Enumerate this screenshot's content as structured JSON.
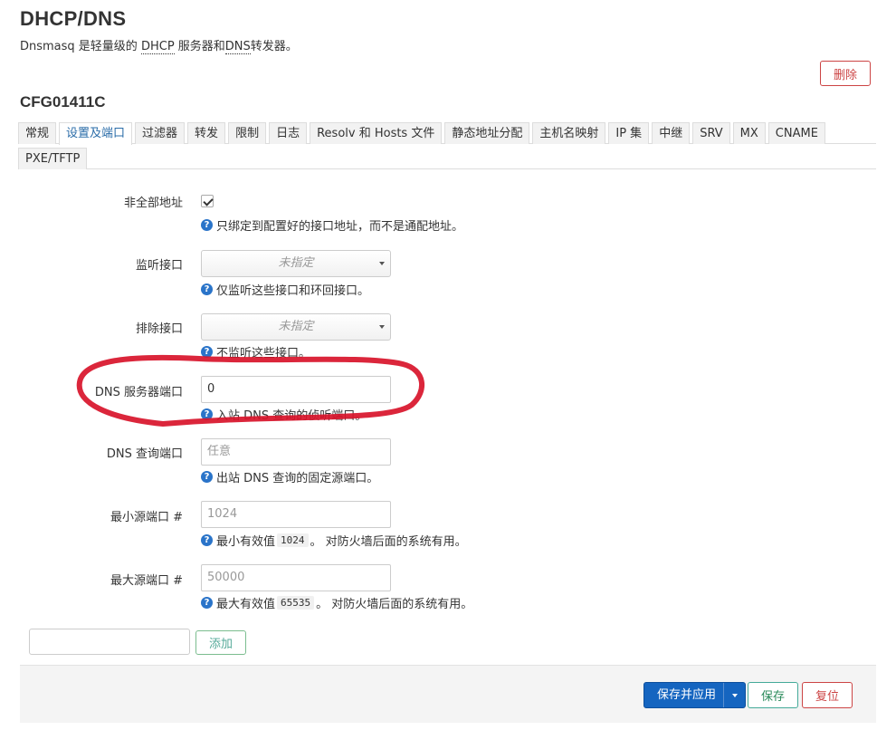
{
  "header": {
    "title": "DHCP/DNS",
    "desc_prefix": "Dnsmasq 是轻量级的 ",
    "desc_dhcp": "DHCP",
    "desc_middle": " 服务器和",
    "desc_dns": "DNS",
    "desc_suffix": "转发器。",
    "delete_label": "删除"
  },
  "section": {
    "title": "CFG01411C"
  },
  "tabs": {
    "row1": [
      "常规",
      "设置及端口",
      "过滤器",
      "转发",
      "限制",
      "日志",
      "Resolv 和 Hosts 文件",
      "静态地址分配",
      "主机名映射",
      "IP 集",
      "中继",
      "SRV",
      "MX",
      "CNAME"
    ],
    "row2": [
      "PXE/TFTP"
    ],
    "active": "设置及端口"
  },
  "form": {
    "nonwildcard": {
      "label": "非全部地址",
      "checked": true,
      "help": "只绑定到配置好的接口地址，而不是通配地址。"
    },
    "listen_iface": {
      "label": "监听接口",
      "value": "未指定",
      "help": "仅监听这些接口和环回接口。"
    },
    "exclude_iface": {
      "label": "排除接口",
      "value": "未指定",
      "help": "不监听这些接口。"
    },
    "dns_port": {
      "label": "DNS 服务器端口",
      "value": "0",
      "help": "入站 DNS 查询的侦听端口。"
    },
    "query_port": {
      "label": "DNS 查询端口",
      "placeholder": "任意",
      "help": "出站 DNS 查询的固定源端口。"
    },
    "min_port": {
      "label": "最小源端口 #",
      "placeholder": "1024",
      "help_prefix": "最小有效值",
      "help_code": "1024",
      "help_suffix": "。 对防火墙后面的系统有用。"
    },
    "max_port": {
      "label": "最大源端口 #",
      "placeholder": "50000",
      "help_prefix": "最大有效值",
      "help_code": "65535",
      "help_suffix": "。 对防火墙后面的系统有用。"
    }
  },
  "add": {
    "label": "添加"
  },
  "footer": {
    "save_apply": "保存并应用",
    "save": "保存",
    "reset": "复位"
  },
  "colors": {
    "annotation": "#d8142a",
    "primary": "#1565c0",
    "danger": "#cc4444",
    "success": "#44aa99"
  }
}
